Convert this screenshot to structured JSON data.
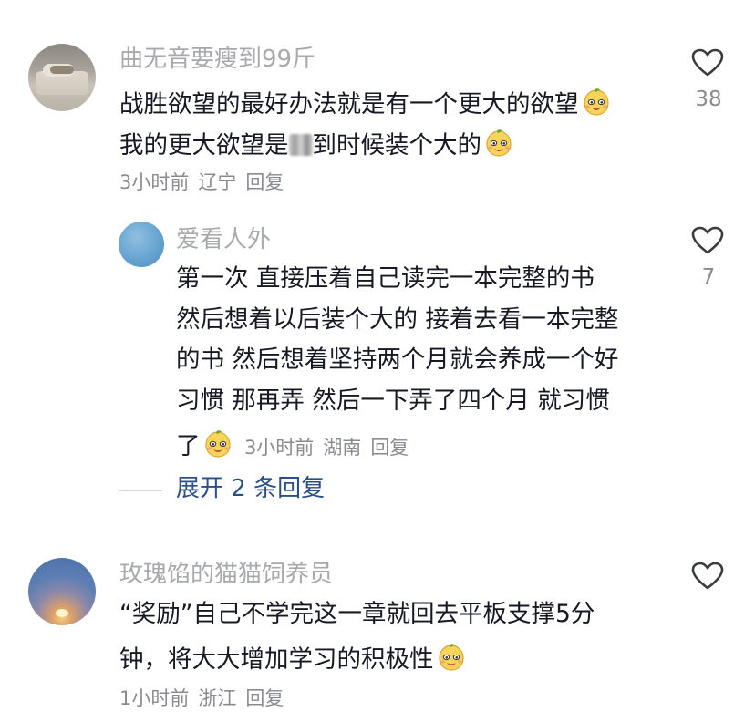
{
  "comments": [
    {
      "username": "曲无音要瘦到99斤",
      "lines": [
        "战胜欲望的最好办法就是有一个更大的欲望",
        "我的更大欲望是",
        "到时候装个大的"
      ],
      "time": "3小时前",
      "location": "辽宁",
      "reply": "回复",
      "likes": "38"
    },
    {
      "username": "爱看人外",
      "lines": [
        "第一次 直接压着自己读完一本完整的书",
        "然后想着以后装个大的 接着去看一本完整",
        "的书 然后想着坚持两个月就会养成一个好",
        "习惯 那再弄 然后一下弄了四个月 就习惯",
        "了"
      ],
      "time": "3小时前",
      "location": "湖南",
      "reply": "回复",
      "likes": "7"
    },
    {
      "username": "玫瑰馅的猫猫饲养员",
      "lines": [
        "“奖励”自己不学完这一章就回去平板支撑5分",
        "钟，将大大增加学习的积极性"
      ],
      "time": "1小时前",
      "location": "浙江",
      "reply": "回复",
      "likes": ""
    }
  ],
  "expand_replies": "展开 2 条回复",
  "colors": {
    "text": "#161823",
    "username": "#a8a9ad",
    "meta": "#8a8b91",
    "link": "#2a4f8b"
  },
  "icons": [
    "heart-outline-icon",
    "smile-emoji-icon"
  ]
}
